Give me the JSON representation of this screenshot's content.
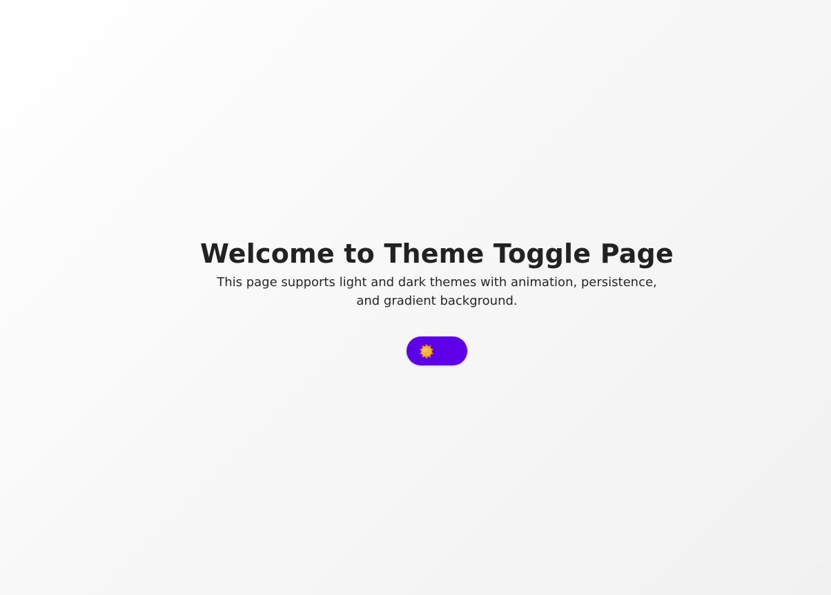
{
  "page": {
    "title": "Welcome to Theme Toggle Page",
    "subtitle": "This page supports light and dark themes with animation, persistence, and gradient background."
  },
  "theme_toggle": {
    "state": "light",
    "icon": "sun-icon",
    "track_color": "#5d00e8",
    "icon_color": "#f0b030"
  }
}
